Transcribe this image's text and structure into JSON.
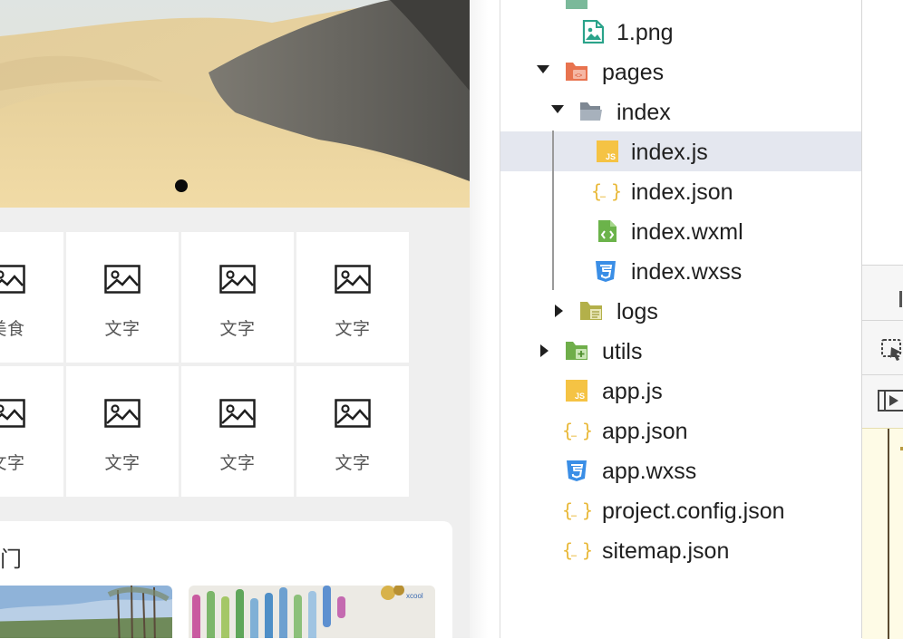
{
  "simulator": {
    "grid": [
      {
        "label": "美食"
      },
      {
        "label": "文字"
      },
      {
        "label": "文字"
      },
      {
        "label": "文字"
      },
      {
        "label": "文字"
      },
      {
        "label": "文字"
      },
      {
        "label": "文字"
      },
      {
        "label": "文字"
      }
    ],
    "section_title": "门",
    "banner_watermark": "xcool"
  },
  "explorer": {
    "items": [
      {
        "label": "1.png",
        "icon": "image-file-icon"
      },
      {
        "label": "pages",
        "icon": "pages-folder-icon",
        "expanded": true
      },
      {
        "label": "index",
        "icon": "folder-open-icon",
        "expanded": true
      },
      {
        "label": "index.js",
        "icon": "js-file-icon",
        "selected": true
      },
      {
        "label": "index.json",
        "icon": "json-file-icon"
      },
      {
        "label": "index.wxml",
        "icon": "wxml-file-icon"
      },
      {
        "label": "index.wxss",
        "icon": "css-file-icon"
      },
      {
        "label": "logs",
        "icon": "folder-icon",
        "expanded": false
      },
      {
        "label": "utils",
        "icon": "utils-folder-icon",
        "expanded": false
      },
      {
        "label": "app.js",
        "icon": "js-file-icon"
      },
      {
        "label": "app.json",
        "icon": "json-file-icon"
      },
      {
        "label": "app.wxss",
        "icon": "css-file-icon"
      },
      {
        "label": "project.config.json",
        "icon": "json-file-icon"
      },
      {
        "label": "sitemap.json",
        "icon": "json-file-icon"
      }
    ]
  },
  "colors": {
    "selected_row": "#e4e7ef",
    "js": "#f5c344",
    "json": "#e9b93a",
    "css": "#3a8ee6",
    "wxml": "#6bb34a",
    "pages_folder": "#e8734f",
    "folder": "#9ea8b4"
  }
}
